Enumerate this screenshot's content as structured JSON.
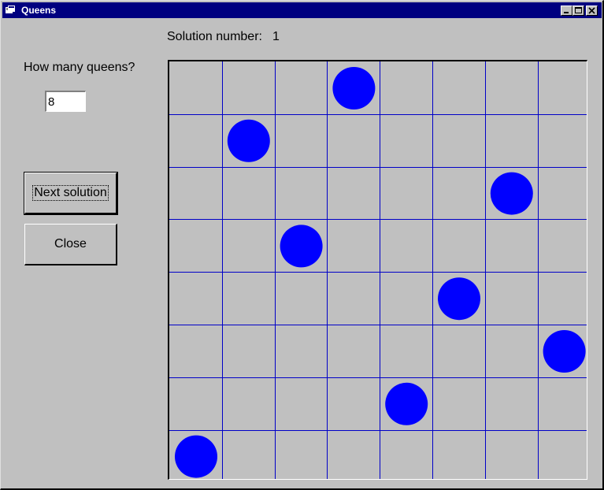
{
  "window": {
    "title": "Queens"
  },
  "titlebar_buttons": {
    "minimize_icon": "minimize-icon",
    "maximize_icon": "maximize-icon",
    "close_icon": "close-icon"
  },
  "solution": {
    "label": "Solution number:",
    "value": "1"
  },
  "prompt": {
    "label": "How many queens?"
  },
  "queens_input": {
    "value": "8"
  },
  "buttons": {
    "next_label": "Next solution",
    "close_label": "Close"
  },
  "board": {
    "size": 8,
    "grid_color": "#0000c8",
    "queen_color": "#0000ff",
    "queen_columns_by_row": [
      3,
      1,
      6,
      2,
      5,
      7,
      4,
      0
    ]
  }
}
